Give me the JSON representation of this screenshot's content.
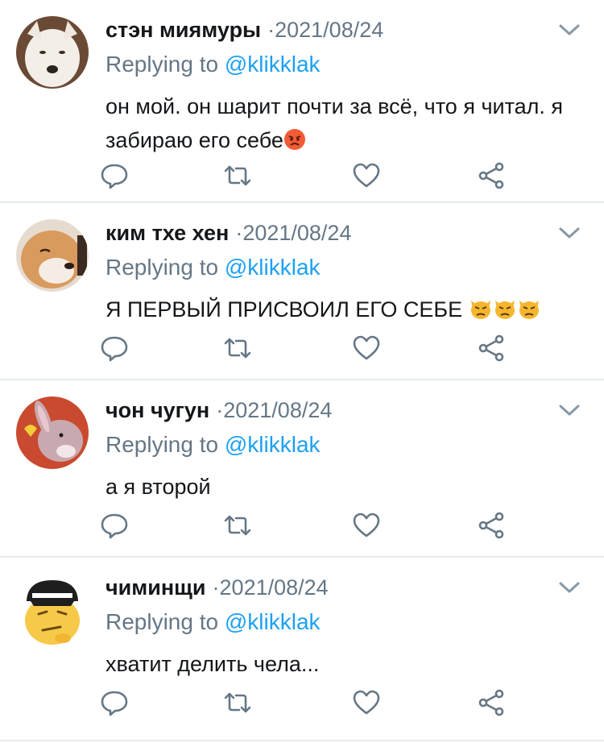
{
  "tweets": [
    {
      "name": "стэн миямуры",
      "date": "·2021/08/24",
      "replying_prefix": "Replying to ",
      "replying_handle": "@klikklak",
      "text": "он мой. он шарит почти за всё, что я читал. я забираю его себе",
      "emojis": [
        "angry-face"
      ]
    },
    {
      "name": "ким тхе хен",
      "date": "·2021/08/24",
      "replying_prefix": "Replying to ",
      "replying_handle": "@klikklak",
      "text": "Я ПЕРВЫЙ ПРИСВОИЛ ЕГО СЕБЕ ",
      "emojis": [
        "pouting-cat",
        "pouting-cat",
        "pouting-cat"
      ]
    },
    {
      "name": "чон чугун",
      "date": "·2021/08/24",
      "replying_prefix": "Replying to ",
      "replying_handle": "@klikklak",
      "text": "а я второй",
      "emojis": []
    },
    {
      "name": "чиминщи",
      "date": "·2021/08/24",
      "replying_prefix": "Replying to ",
      "replying_handle": "@klikklak",
      "text": "хватит делить чела...",
      "emojis": []
    }
  ],
  "icons": {
    "reply": "reply-icon",
    "retweet": "retweet-icon",
    "like": "heart-icon",
    "share": "share-icon",
    "caret": "chevron-down-icon"
  },
  "colors": {
    "muted": "#657786",
    "link": "#1da1f2",
    "divider": "#e6ecf0"
  }
}
